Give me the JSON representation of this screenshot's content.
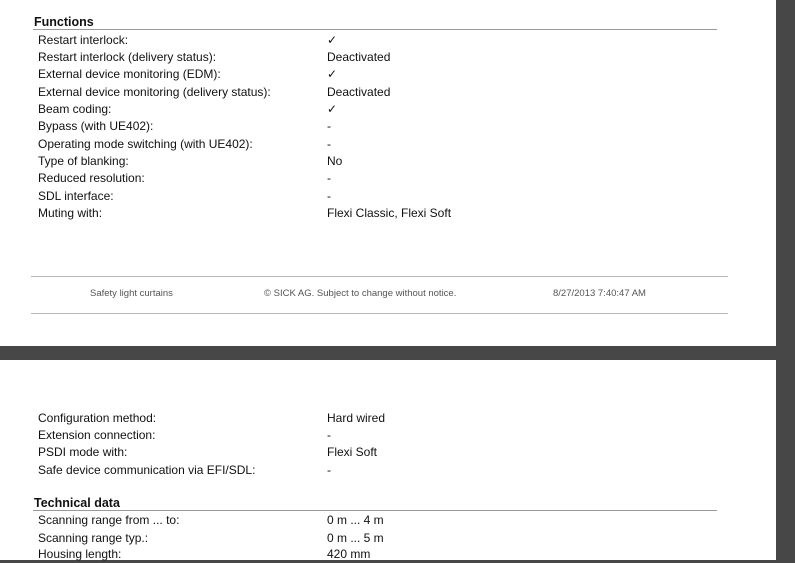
{
  "page1": {
    "section_title": "Functions",
    "rows": [
      {
        "label": "Restart interlock:",
        "value": "✓"
      },
      {
        "label": "Restart interlock (delivery status):",
        "value": "Deactivated"
      },
      {
        "label": "External device monitoring (EDM):",
        "value": "✓"
      },
      {
        "label": "External device monitoring (delivery status):",
        "value": "Deactivated"
      },
      {
        "label": "Beam coding:",
        "value": "✓"
      },
      {
        "label": "Bypass (with UE402):",
        "value": "-"
      },
      {
        "label": "Operating mode switching (with UE402):",
        "value": "-"
      },
      {
        "label": "Type of blanking:",
        "value": "No"
      },
      {
        "label": "Reduced resolution:",
        "value": "-"
      },
      {
        "label": "SDL interface:",
        "value": "-"
      },
      {
        "label": "Muting with:",
        "value": "Flexi Classic, Flexi Soft"
      }
    ],
    "footer": {
      "left": "Safety light curtains",
      "center": "© SICK AG. Subject to change without notice.",
      "right": "8/27/2013 7:40:47 AM"
    }
  },
  "page2": {
    "rows": [
      {
        "label": "Configuration method:",
        "value": "Hard wired"
      },
      {
        "label": "Extension connection:",
        "value": "-"
      },
      {
        "label": "PSDI mode with:",
        "value": "Flexi Soft"
      },
      {
        "label": "Safe device communication via EFI/SDL:",
        "value": "-"
      }
    ],
    "technical_section_title": "Technical data",
    "technical_rows": [
      {
        "label": "Scanning range from ... to:",
        "value": "0 m ... 4 m"
      },
      {
        "label": "Scanning range typ.:",
        "value": "0 m ... 5 m"
      },
      {
        "label": "Housing length:",
        "value": "420 mm"
      }
    ]
  }
}
